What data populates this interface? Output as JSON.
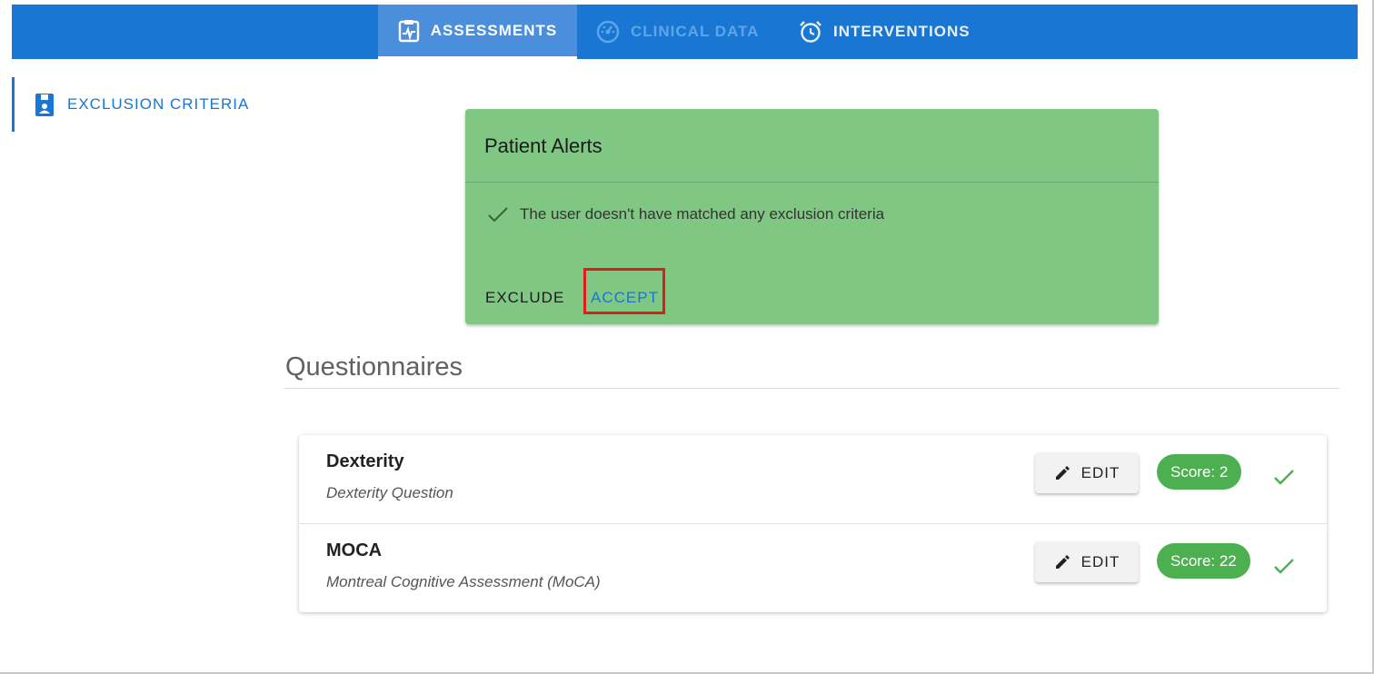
{
  "nav": {
    "tabs": [
      {
        "label": "ASSESSMENTS",
        "icon": "clipboard-pulse-icon",
        "active": true
      },
      {
        "label": "CLINICAL DATA",
        "icon": "speedometer-icon",
        "active": false
      },
      {
        "label": "INTERVENTIONS",
        "icon": "alarm-clock-icon",
        "active": false
      }
    ]
  },
  "sidebar": {
    "items": [
      {
        "label": "EXCLUSION CRITERIA",
        "icon": "patient-file-icon",
        "active": true
      }
    ]
  },
  "alert": {
    "title": "Patient Alerts",
    "message": "The user doesn't have matched any exclusion criteria",
    "exclude_label": "EXCLUDE",
    "accept_label": "ACCEPT"
  },
  "questionnaires": {
    "title": "Questionnaires",
    "items": [
      {
        "title": "Dexterity",
        "subtitle": "Dexterity Question",
        "edit_label": "EDIT",
        "score_label": "Score: 2"
      },
      {
        "title": "MOCA",
        "subtitle": "Montreal Cognitive Assessment (MoCA)",
        "edit_label": "EDIT",
        "score_label": "Score: 22"
      }
    ]
  },
  "colors": {
    "primary": "#1976d2",
    "alert_bg": "#81c784",
    "score_bg": "#4caf50",
    "highlight": "#e21c1c"
  }
}
